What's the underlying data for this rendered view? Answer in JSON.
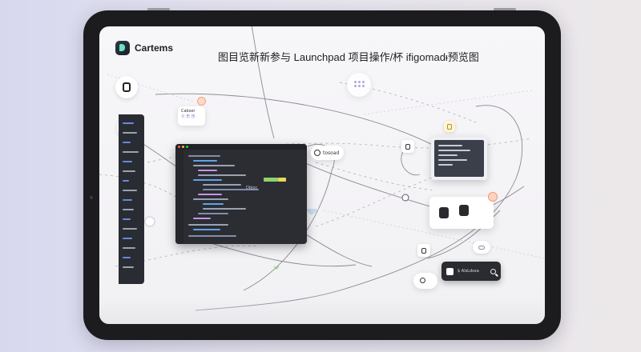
{
  "app": {
    "brand_name": "Cartems",
    "page_title": "图目览新新参与 Launchpad 项目操作/杯 ifigomadᵻ预览图"
  },
  "sidebar": {
    "items": [
      {
        "icon": "document-icon"
      },
      {
        "icon": "chair-icon"
      }
    ]
  },
  "canvas": {
    "note_card_text": [
      "Cabser",
      "ㅁ 乐 乐"
    ],
    "status_chip_label": "tosoad",
    "editor_label": "Dbjoc",
    "app_button_label": "$ AlsLdsxa"
  },
  "colors": {
    "background": "#e4e2ee",
    "tablet_frame": "#1c1c1e",
    "editor_bg": "#2b2d33",
    "accent_green": "#8fd46a",
    "accent_yellow": "#e8d75a",
    "accent_purple": "#b6a7d8",
    "badge_peach": "#ffd3c0"
  }
}
